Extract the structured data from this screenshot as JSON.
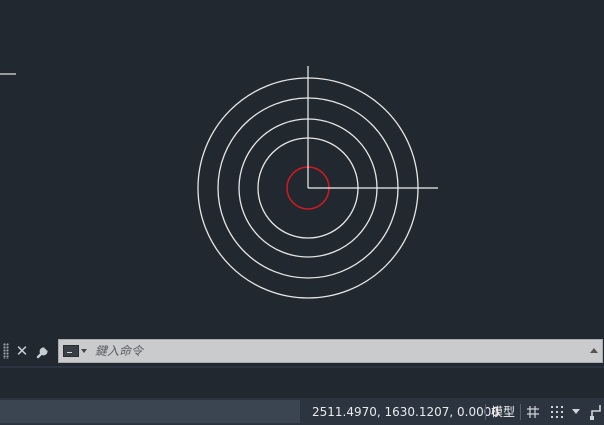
{
  "command_line": {
    "placeholder": "鍵入命令",
    "icons": [
      "grip-handle",
      "close-icon",
      "wrench-icon",
      "command-prompt-icon",
      "chevron-down-icon",
      "scroll-up-icon"
    ]
  },
  "status_bar": {
    "coordinates": "2511.4970, 1630.1207, 0.0000",
    "model_label": "模型",
    "icons": [
      "grid-icon",
      "snap-icon",
      "chevron-down-icon",
      "infer-constraints-icon"
    ]
  },
  "canvas": {
    "background": "#212830",
    "geometry_color": "#e6e6e6",
    "selected_color": "#cc1a22",
    "objects": [
      "outer-circle",
      "circle-3",
      "circle-2",
      "circle-1",
      "selected-circle",
      "crosshair-cursor",
      "ucs-axis-line"
    ]
  }
}
